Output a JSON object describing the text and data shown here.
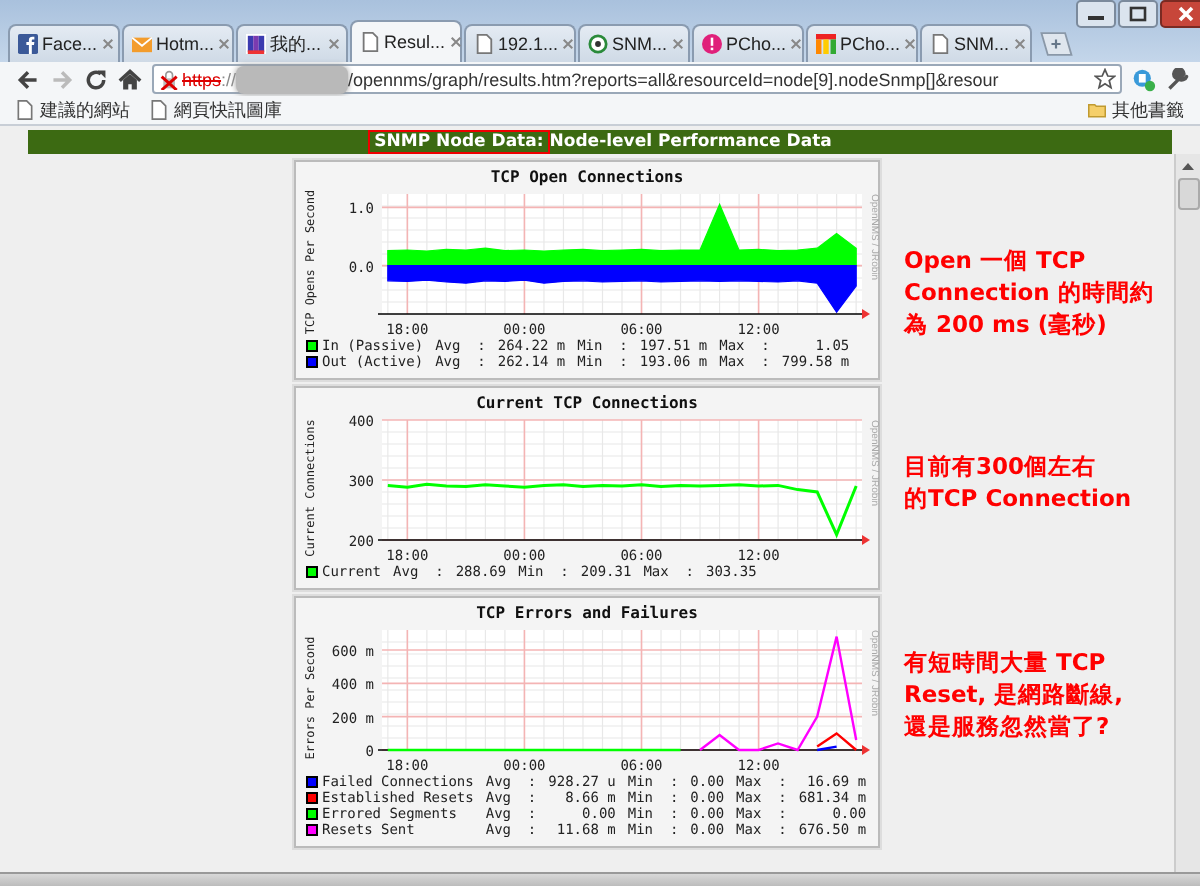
{
  "tabs": [
    {
      "label": "Face...",
      "kind": "fb",
      "selected": false
    },
    {
      "label": "Hotm...",
      "kind": "mail",
      "selected": false
    },
    {
      "label": "我的...",
      "kind": "stripes",
      "selected": false
    },
    {
      "label": "Resul...",
      "kind": "page",
      "selected": true
    },
    {
      "label": "192.1...",
      "kind": "page",
      "selected": false
    },
    {
      "label": "SNM...",
      "kind": "ring",
      "selected": false
    },
    {
      "label": "PCho...",
      "kind": "dot",
      "selected": false
    },
    {
      "label": "PCho...",
      "kind": "bars",
      "selected": false
    },
    {
      "label": "SNM...",
      "kind": "page",
      "selected": false
    }
  ],
  "address": {
    "scheme": "https",
    "scheme_sep": "://",
    "path": "/opennms/graph/results.htm?reports=all&resourceId=node[9].nodeSnmp[]&resour",
    "insecure": true
  },
  "bookmarks": [
    {
      "label": "建議的網站"
    },
    {
      "label": "網頁快訊圖庫"
    }
  ],
  "other_bookmarks": "其他書籤",
  "header": {
    "highlighted": "SNMP Node Data:",
    "rest": "Node-level Performance Data"
  },
  "panels": [
    {
      "credit": "OpenNMS / JRobin",
      "chart_data": {
        "type": "area",
        "title": "TCP Open Connections",
        "ylabel": "TCP Opens Per Second",
        "grid": true,
        "legend": "bottom",
        "categories": [
          null,
          "18:00",
          null,
          null,
          null,
          null,
          null,
          "00:00",
          null,
          null,
          null,
          null,
          null,
          "06:00",
          null,
          null,
          null,
          null,
          null,
          "12:00",
          null,
          null,
          null,
          null,
          null
        ],
        "ylim": [
          -0.83,
          1.23
        ],
        "yticks": [
          {
            "value": 0,
            "label": "0.0"
          },
          {
            "value": 1,
            "label": "1.0"
          }
        ],
        "series": [
          {
            "name": "In (Passive)",
            "color": "#00ff00",
            "values": [
              0.26,
              0.27,
              0.25,
              0.28,
              0.27,
              0.3,
              0.26,
              0.27,
              0.25,
              0.27,
              0.28,
              0.26,
              0.27,
              0.28,
              0.26,
              0.27,
              0.27,
              1.05,
              0.27,
              0.28,
              0.26,
              0.27,
              0.3,
              0.55,
              0.3
            ]
          },
          {
            "name": "Out (Active)",
            "color": "#0000ff",
            "values": [
              -0.26,
              -0.27,
              -0.25,
              -0.28,
              -0.3,
              -0.26,
              -0.27,
              -0.25,
              -0.3,
              -0.27,
              -0.26,
              -0.28,
              -0.27,
              -0.26,
              -0.28,
              -0.27,
              -0.26,
              -0.27,
              -0.26,
              -0.27,
              -0.28,
              -0.26,
              -0.3,
              -0.8,
              -0.35
            ]
          }
        ]
      },
      "legend_stats": [
        {
          "stats": [
            {
              "label": "Avg  :",
              "value": "264.22 m"
            },
            {
              "label": "Min  :",
              "value": "197.51 m"
            },
            {
              "label": "Max  :",
              "value": "1.05"
            }
          ]
        },
        {
          "stats": [
            {
              "label": "Avg  :",
              "value": "262.14 m"
            },
            {
              "label": "Min  :",
              "value": "193.06 m"
            },
            {
              "label": "Max  :",
              "value": "799.58 m"
            }
          ]
        }
      ]
    },
    {
      "credit": "OpenNMS / JRobin",
      "chart_data": {
        "type": "line",
        "title": "Current TCP Connections",
        "ylabel": "Current Connections",
        "grid": true,
        "legend": "bottom",
        "categories": [
          null,
          "18:00",
          null,
          null,
          null,
          null,
          null,
          "00:00",
          null,
          null,
          null,
          null,
          null,
          "06:00",
          null,
          null,
          null,
          null,
          null,
          "12:00",
          null,
          null,
          null,
          null,
          null
        ],
        "ylim": [
          200,
          400
        ],
        "yticks": [
          200,
          300,
          400
        ],
        "series": [
          {
            "name": "Current",
            "color": "#00ff00",
            "values": [
              291,
              288,
              293,
              290,
              289,
              292,
              290,
              288,
              291,
              292,
              289,
              291,
              290,
              292,
              289,
              291,
              290,
              291,
              292,
              290,
              291,
              284,
              280,
              209,
              290
            ]
          }
        ]
      },
      "legend_stats": [
        {
          "stats": [
            {
              "label": "Avg  :",
              "value": "288.69"
            },
            {
              "label": "Min  :",
              "value": "209.31"
            },
            {
              "label": "Max  :",
              "value": "303.35"
            }
          ]
        }
      ]
    },
    {
      "credit": "OpenNMS / JRobin",
      "chart_data": {
        "type": "line",
        "title": "TCP Errors and Failures",
        "ylabel": "Errors Per Second",
        "grid": true,
        "legend": "bottom",
        "categories": [
          null,
          "18:00",
          null,
          null,
          null,
          null,
          null,
          "00:00",
          null,
          null,
          null,
          null,
          null,
          "06:00",
          null,
          null,
          null,
          null,
          null,
          "12:00",
          null,
          null,
          null,
          null,
          null
        ],
        "ylim": [
          0,
          720
        ],
        "yticks": [
          {
            "value": 0,
            "label": "0"
          },
          {
            "value": 200,
            "label": "200 m"
          },
          {
            "value": 400,
            "label": "400 m"
          },
          {
            "value": 600,
            "label": "600 m"
          }
        ],
        "series": [
          {
            "name": "Failed Connections",
            "color": "#0000ff",
            "values": [
              null,
              null,
              null,
              null,
              null,
              null,
              null,
              null,
              null,
              null,
              null,
              null,
              null,
              null,
              null,
              null,
              null,
              null,
              null,
              null,
              null,
              null,
              0,
              20,
              null
            ]
          },
          {
            "name": "Established Resets",
            "color": "#ff0000",
            "values": [
              null,
              null,
              null,
              null,
              null,
              null,
              null,
              null,
              null,
              null,
              null,
              null,
              null,
              null,
              null,
              null,
              null,
              null,
              null,
              null,
              null,
              null,
              20,
              100,
              0
            ]
          },
          {
            "name": "Errored Segments",
            "color": "#00ff00",
            "values": [
              0,
              0,
              0,
              0,
              0,
              0,
              0,
              0,
              0,
              0,
              0,
              0,
              0,
              0,
              0,
              0,
              null,
              null,
              null,
              null,
              null,
              null,
              null,
              null,
              null
            ]
          },
          {
            "name": "Resets Sent",
            "color": "#ff00ff",
            "values": [
              null,
              null,
              null,
              null,
              null,
              null,
              null,
              null,
              null,
              null,
              null,
              null,
              null,
              null,
              null,
              null,
              0,
              90,
              0,
              0,
              40,
              0,
              200,
              680,
              60
            ]
          }
        ]
      },
      "legend_stats": [
        {
          "stats": [
            {
              "label": "Avg  :",
              "value": "928.27 u"
            },
            {
              "label": "Min  :",
              "value": "0.00"
            },
            {
              "label": "Max  :",
              "value": "16.69 m"
            }
          ]
        },
        {
          "stats": [
            {
              "label": "Avg  :",
              "value": "8.66 m"
            },
            {
              "label": "Min  :",
              "value": "0.00"
            },
            {
              "label": "Max  :",
              "value": "681.34 m"
            }
          ]
        },
        {
          "stats": [
            {
              "label": "Avg  :",
              "value": "0.00"
            },
            {
              "label": "Min  :",
              "value": "0.00"
            },
            {
              "label": "Max  :",
              "value": "0.00"
            }
          ]
        },
        {
          "stats": [
            {
              "label": "Avg  :",
              "value": "11.68 m"
            },
            {
              "label": "Min  :",
              "value": "0.00"
            },
            {
              "label": "Max  :",
              "value": "676.50 m"
            }
          ]
        }
      ]
    }
  ],
  "notes": [
    {
      "lines": [
        "Open 一個 TCP",
        "Connection 的時間約",
        "為 200 ms (毫秒)"
      ]
    },
    {
      "lines": [
        "目前有300個左右",
        "的TCP Connection"
      ]
    },
    {
      "lines": [
        "有短時間大量 TCP",
        "Reset, 是網路斷線,",
        "還是服務忽然當了?"
      ]
    }
  ]
}
